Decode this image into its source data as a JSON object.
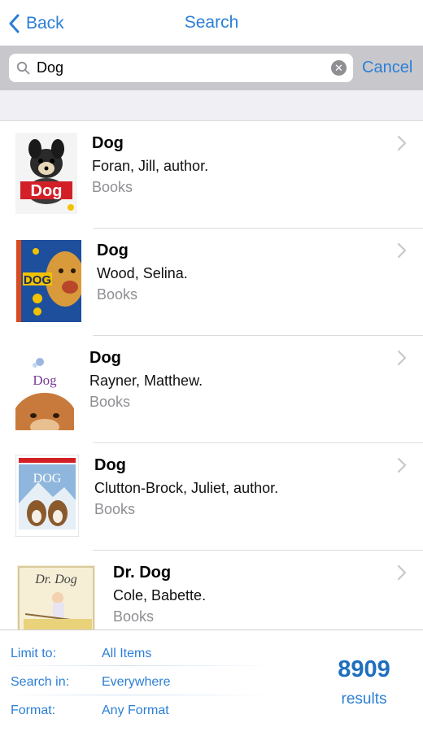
{
  "nav": {
    "back_label": "Back",
    "title": "Search"
  },
  "search": {
    "value": "Dog",
    "cancel_label": "Cancel"
  },
  "results": [
    {
      "title": "Dog",
      "author": "Foran, Jill, author.",
      "format": "Books",
      "cover_text": "Dog"
    },
    {
      "title": "Dog",
      "author": "Wood, Selina.",
      "format": "Books",
      "cover_text": "DOG"
    },
    {
      "title": "Dog",
      "author": "Rayner, Matthew.",
      "format": "Books",
      "cover_text": "Dog"
    },
    {
      "title": "Dog",
      "author": "Clutton-Brock, Juliet, author.",
      "format": "Books",
      "cover_text": "DOG"
    },
    {
      "title": "Dr. Dog",
      "author": "Cole, Babette.",
      "format": "Books",
      "cover_text": "Dr. Dog"
    }
  ],
  "filters": {
    "limit": {
      "label": "Limit to:",
      "value": "All Items"
    },
    "search_in": {
      "label": "Search in:",
      "value": "Everywhere"
    },
    "format": {
      "label": "Format:",
      "value": "Any Format"
    }
  },
  "count": {
    "number": "8909",
    "label": "results"
  },
  "colors": {
    "accent": "#2b7fd6",
    "search_bar_bg": "#c8c8cc",
    "section_bg": "#efeff4"
  },
  "icons": {
    "back": "chevron-left-icon",
    "search": "magnifier-icon",
    "clear": "clear-x-icon",
    "disclosure": "chevron-right-icon"
  }
}
